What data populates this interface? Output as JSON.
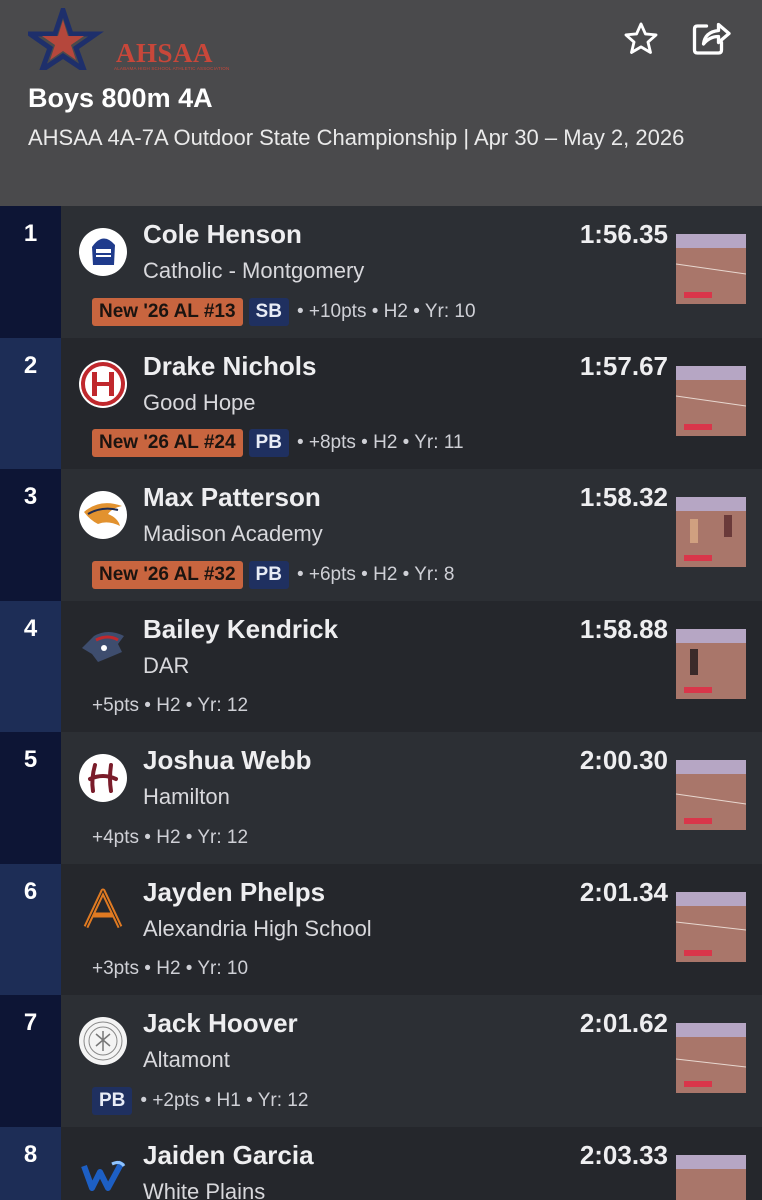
{
  "header": {
    "logo_text": "AHSAA",
    "logo_subtext": "ALABAMA HIGH SCHOOL ATHLETIC ASSOCIATION",
    "title": "Boys 800m 4A",
    "subtitle": "AHSAA 4A-7A Outdoor State Championship | Apr 30 – May 2, 2026",
    "star_icon": "star-outline-icon",
    "share_icon": "share-icon"
  },
  "colors": {
    "header_bg": "#4a4a4c",
    "rank_badge": "#c8653f",
    "pb_badge": "#1f3060",
    "place_col_dark": "#0d1535",
    "place_col_light": "#1d2d56"
  },
  "results": [
    {
      "place": "1",
      "name": "Cole Henson",
      "school": "Catholic - Montgomery",
      "time": "1:56.35",
      "rank_badge": "New '26 AL #13",
      "record_badge": "SB",
      "details": "• +10pts • H2 • Yr: 10"
    },
    {
      "place": "2",
      "name": "Drake Nichols",
      "school": "Good Hope",
      "time": "1:57.67",
      "rank_badge": "New '26 AL #24",
      "record_badge": "PB",
      "details": "• +8pts • H2 • Yr: 11"
    },
    {
      "place": "3",
      "name": "Max Patterson",
      "school": "Madison Academy",
      "time": "1:58.32",
      "rank_badge": "New '26 AL #32",
      "record_badge": "PB",
      "details": "• +6pts • H2 • Yr: 8"
    },
    {
      "place": "4",
      "name": "Bailey Kendrick",
      "school": "DAR",
      "time": "1:58.88",
      "details": "+5pts • H2 • Yr: 12"
    },
    {
      "place": "5",
      "name": "Joshua Webb",
      "school": "Hamilton",
      "time": "2:00.30",
      "details": "+4pts • H2 • Yr: 12"
    },
    {
      "place": "6",
      "name": "Jayden Phelps",
      "school": "Alexandria High School",
      "time": "2:01.34",
      "details": "+3pts • H2 • Yr: 10"
    },
    {
      "place": "7",
      "name": "Jack Hoover",
      "school": "Altamont",
      "time": "2:01.62",
      "record_badge": "PB",
      "details": "• +2pts • H1 • Yr: 12"
    },
    {
      "place": "8",
      "name": "Jaiden Garcia",
      "school": "White Plains",
      "time": "2:03.33"
    }
  ]
}
